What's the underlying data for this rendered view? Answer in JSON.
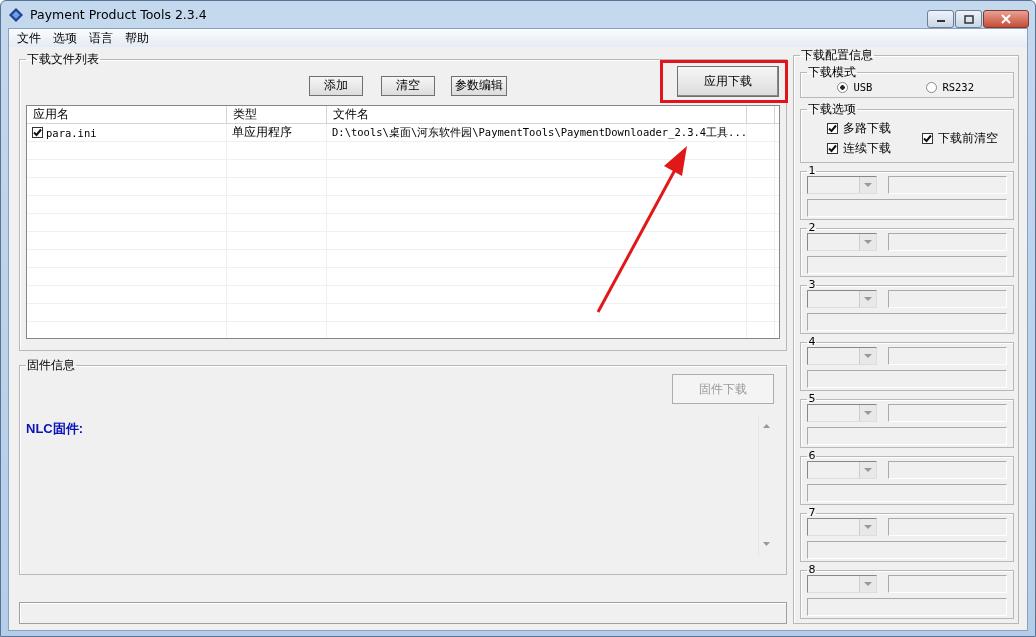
{
  "window": {
    "title": "Payment Product Tools 2.3.4"
  },
  "menu": [
    "文件",
    "选项",
    "语言",
    "帮助"
  ],
  "file_list": {
    "title": "下载文件列表",
    "buttons": [
      "添加",
      "清空",
      "参数编辑"
    ],
    "download_button": "应用下载",
    "columns": [
      "应用名",
      "类型",
      "文件名"
    ],
    "rows": [
      {
        "checked": true,
        "app_name": "para.ini",
        "type": "单应用程序",
        "file": "D:\\tools\\桌面\\河东软件园\\PaymentTools\\PaymentDownloader_2.3.4工具..."
      }
    ]
  },
  "firmware": {
    "title": "固件信息",
    "button": {
      "label": "固件下载",
      "disabled": true
    },
    "label": "NLC固件:"
  },
  "config": {
    "title": "下载配置信息",
    "mode": {
      "title": "下载模式",
      "options": [
        {
          "label": "USB",
          "selected": true
        },
        {
          "label": "RS232",
          "selected": false
        }
      ]
    },
    "options": {
      "title": "下载选项",
      "checks": [
        {
          "label": "多路下载",
          "checked": true
        },
        {
          "label": "连续下载",
          "checked": true
        },
        {
          "label": "下载前清空",
          "checked": true
        }
      ]
    },
    "slots": [
      "1",
      "2",
      "3",
      "4",
      "5",
      "6",
      "7",
      "8"
    ]
  }
}
